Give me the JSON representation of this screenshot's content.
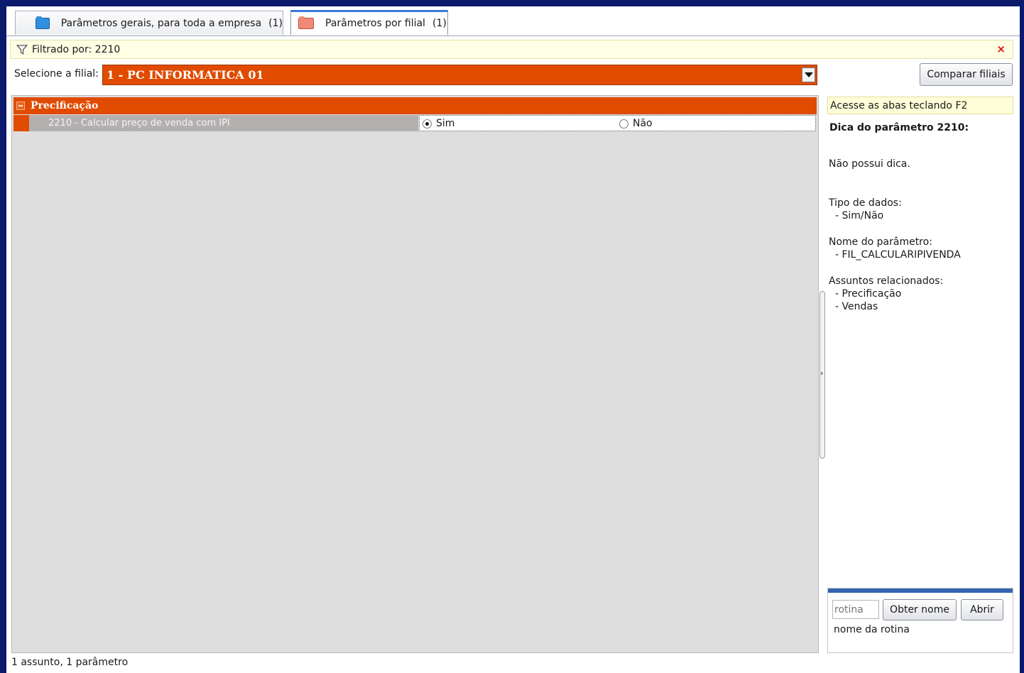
{
  "tabs": [
    {
      "label": "Parâmetros gerais, para toda a empresa",
      "count": "(1)",
      "icon": "folder-blue-icon",
      "active": false
    },
    {
      "label": "Parâmetros por filial",
      "count": "(1)",
      "icon": "folder-red-icon",
      "active": true
    }
  ],
  "filter": {
    "text": "Filtrado por: 2210",
    "close": "×"
  },
  "branch": {
    "label": "Selecione a filial:",
    "value": "1 - PC INFORMATICA 01"
  },
  "compare_button": "Comparar filiais",
  "grid": {
    "group": "Precificação",
    "rows": [
      {
        "name": "2210 - Calcular preço de venda com IPI",
        "options": [
          "Sim",
          "Não"
        ],
        "selected": "Sim"
      }
    ]
  },
  "tip_panel": {
    "hint": "Acesse as abas teclando F2",
    "title": "Dica do parâmetro 2210:",
    "no_tip": "Não possui dica.",
    "data_type_label": "Tipo de dados:",
    "data_type_value": "- Sim/Não",
    "param_name_label": "Nome do parâmetro:",
    "param_name_value": "- FIL_CALCULARIPIVENDA",
    "related_label": "Assuntos relacionados:",
    "related": [
      "- Precificação",
      "- Vendas"
    ]
  },
  "routine": {
    "placeholder": "rotina",
    "get_name_button": "Obter nome",
    "open_button": "Abrir",
    "name_label": "nome da rotina"
  },
  "status": "1 assunto, 1 parâmetro",
  "colors": {
    "accent_orange": "#e04b00",
    "frame_navy": "#0b1a6b",
    "hint_yellow": "#fefed8"
  }
}
